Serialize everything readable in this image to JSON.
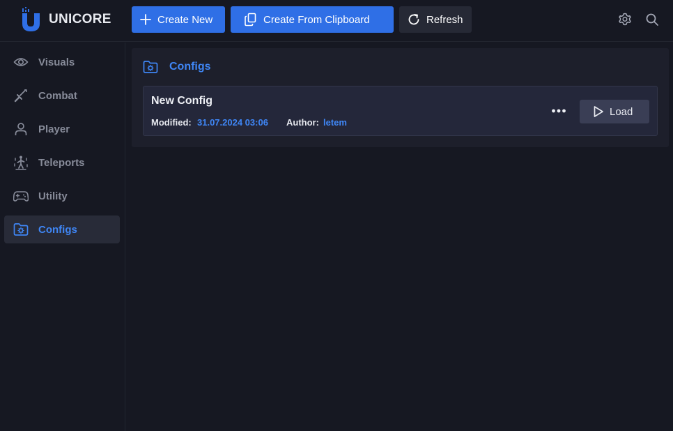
{
  "app": {
    "name": "UNICORE"
  },
  "toolbar": {
    "create_new_label": "Create New",
    "create_from_clipboard_label": "Create From Clipboard",
    "refresh_label": "Refresh"
  },
  "sidebar": {
    "items": [
      {
        "label": "Visuals",
        "icon": "eye-icon",
        "active": false
      },
      {
        "label": "Combat",
        "icon": "sword-icon",
        "active": false
      },
      {
        "label": "Player",
        "icon": "user-icon",
        "active": false
      },
      {
        "label": "Teleports",
        "icon": "teleport-icon",
        "active": false
      },
      {
        "label": "Utility",
        "icon": "gamepad-icon",
        "active": false
      },
      {
        "label": "Configs",
        "icon": "folder-gear-icon",
        "active": true
      }
    ]
  },
  "main": {
    "section_title": "Configs",
    "configs": [
      {
        "name": "New Config",
        "modified_label": "Modified:",
        "modified_value": "31.07.2024 03:06",
        "author_label": "Author:",
        "author_value": "letem",
        "load_label": "Load"
      }
    ]
  },
  "colors": {
    "background": "#161822",
    "accent": "#2f6fe6",
    "accent_text": "#3f86f5",
    "panel": "#1d1f2b",
    "card": "#24273a",
    "muted_text": "#878b99"
  }
}
